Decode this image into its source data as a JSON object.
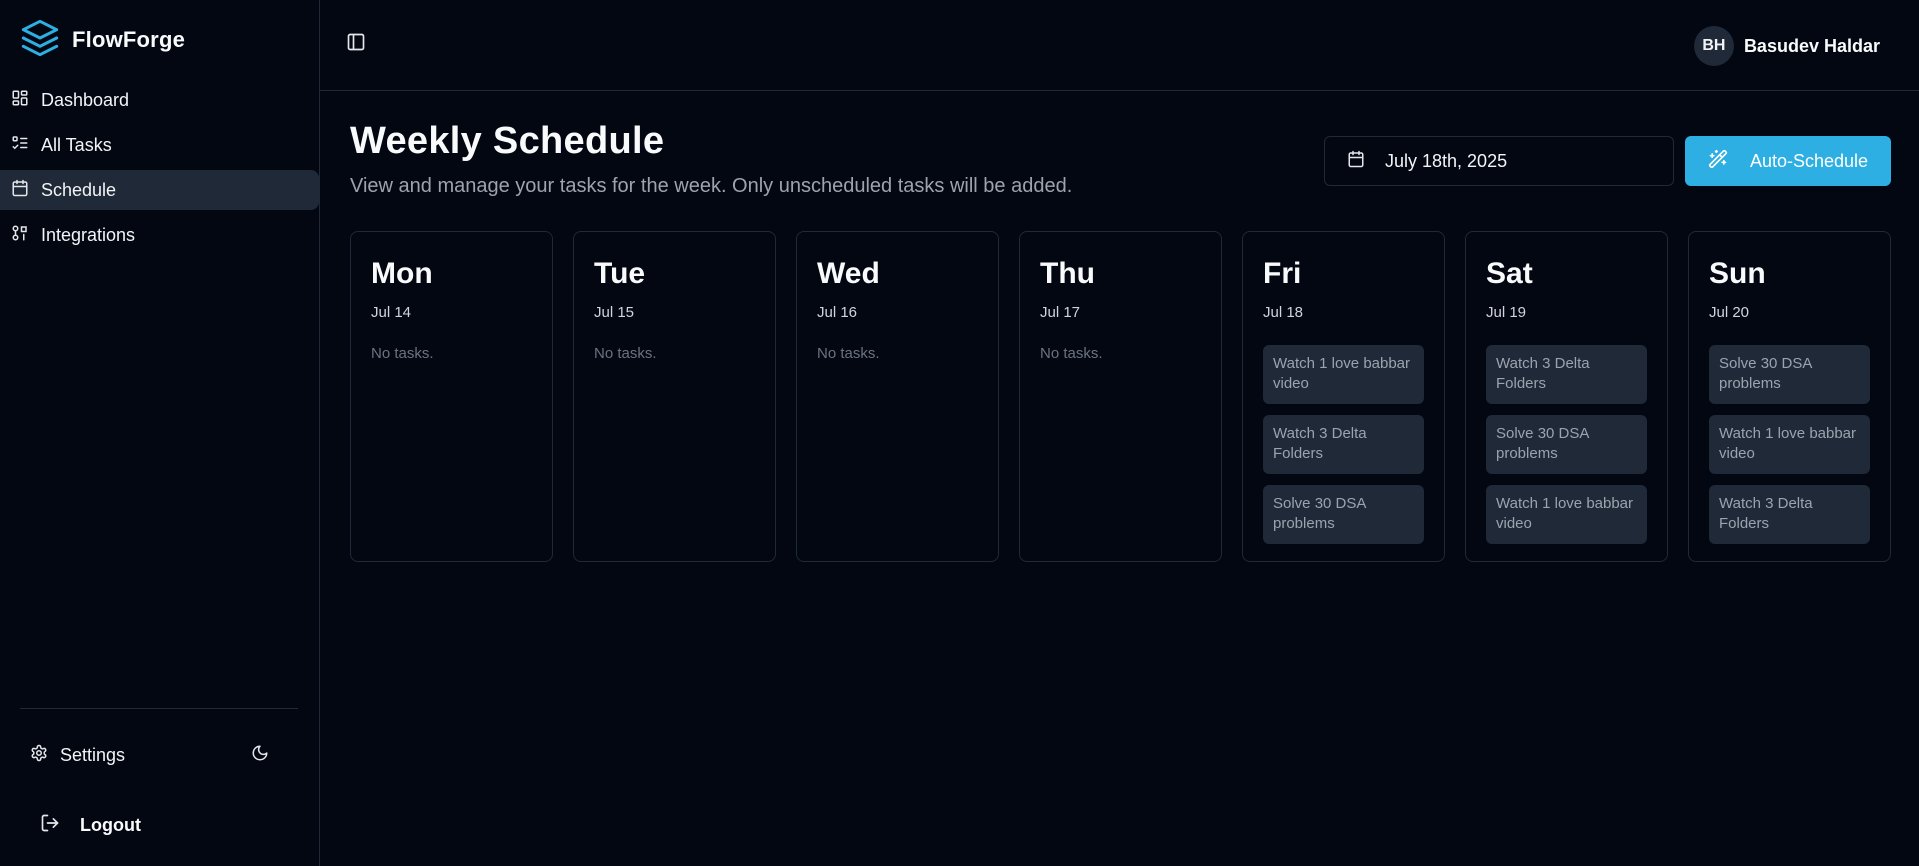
{
  "brand": {
    "name": "FlowForge",
    "logo_icon": "layers-icon",
    "accent": "#2eafe3"
  },
  "sidebar": {
    "items": [
      {
        "label": "Dashboard",
        "icon": "dashboard-icon",
        "active": false
      },
      {
        "label": "All Tasks",
        "icon": "list-icon",
        "active": false
      },
      {
        "label": "Schedule",
        "icon": "calendar-icon",
        "active": true
      },
      {
        "label": "Integrations",
        "icon": "integrations-icon",
        "active": false
      }
    ],
    "settings_label": "Settings",
    "logout_label": "Logout"
  },
  "header": {
    "user_initials": "BH",
    "user_name": "Basudev Haldar"
  },
  "main": {
    "title": "Weekly Schedule",
    "subtitle": "View and manage your tasks for the week. Only unscheduled tasks will be added.",
    "date_value": "July 18th, 2025",
    "auto_schedule_label": "Auto-Schedule",
    "days": [
      {
        "name": "Mon",
        "date": "Jul 14",
        "empty_text": "No tasks.",
        "tasks": []
      },
      {
        "name": "Tue",
        "date": "Jul 15",
        "empty_text": "No tasks.",
        "tasks": []
      },
      {
        "name": "Wed",
        "date": "Jul 16",
        "empty_text": "No tasks.",
        "tasks": []
      },
      {
        "name": "Thu",
        "date": "Jul 17",
        "empty_text": "No tasks.",
        "tasks": []
      },
      {
        "name": "Fri",
        "date": "Jul 18",
        "tasks": [
          "Watch 1 love babbar video",
          "Watch 3 Delta Folders",
          "Solve 30 DSA problems"
        ]
      },
      {
        "name": "Sat",
        "date": "Jul 19",
        "tasks": [
          "Watch 3 Delta Folders",
          "Solve 30 DSA problems",
          "Watch 1 love babbar video"
        ]
      },
      {
        "name": "Sun",
        "date": "Jul 20",
        "tasks": [
          "Solve 30 DSA problems",
          "Watch 1 love babbar video",
          "Watch 3 Delta Folders"
        ]
      }
    ]
  }
}
